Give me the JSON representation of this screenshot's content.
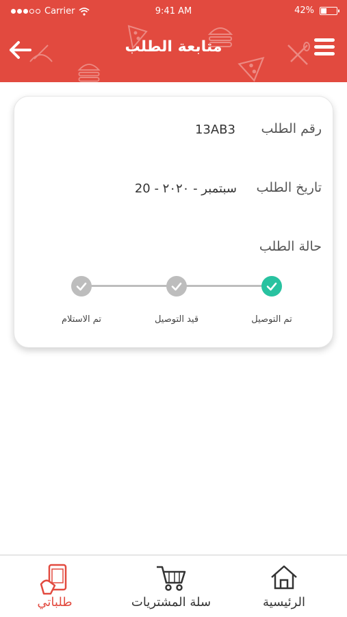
{
  "status_bar": {
    "carrier": "Carrier",
    "time": "9:41 AM",
    "battery": "42%",
    "battery_level": 0.42
  },
  "header": {
    "title": "متابعة الطلب",
    "back_icon": "arrow-left-icon",
    "menu_icon": "hamburger-menu-icon",
    "background_color": "#e24a3f"
  },
  "order": {
    "number_label": "رقم الطلب",
    "number_value": "13AB3",
    "date_label": "تاريخ الطلب",
    "date_value": "سبتمبر - ٢٠٢٠ - 20",
    "status_label": "حالة الطلب",
    "steps": [
      {
        "label": "تم التوصيل",
        "state": "done",
        "color": "#28c2a0"
      },
      {
        "label": "قيد التوصيل",
        "state": "pending",
        "color": "#bdbdbd"
      },
      {
        "label": "تم الاستلام",
        "state": "pending",
        "color": "#bdbdbd"
      }
    ]
  },
  "bottom_nav": {
    "items": [
      {
        "label": "الرئيسية",
        "icon": "home-icon",
        "active": false
      },
      {
        "label": "سلة المشتريات",
        "icon": "cart-icon",
        "active": false
      },
      {
        "label": "طلباتي",
        "icon": "phone-order-icon",
        "active": true
      }
    ],
    "active_color": "#e24a3f",
    "inactive_color": "#333333"
  }
}
